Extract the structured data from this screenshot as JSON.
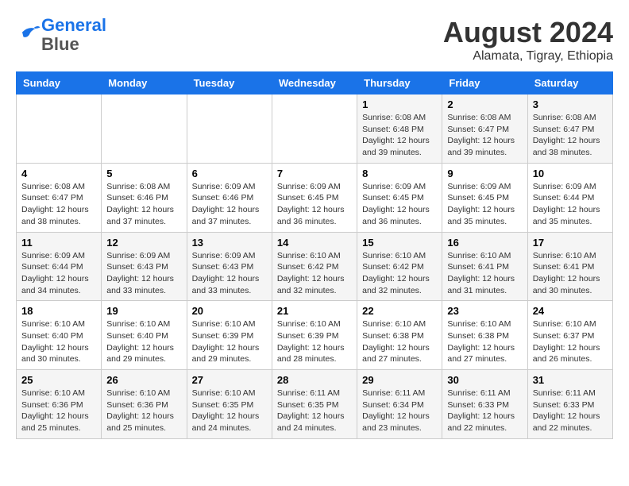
{
  "header": {
    "logo_line1": "General",
    "logo_line2": "Blue",
    "month": "August 2024",
    "location": "Alamata, Tigray, Ethiopia"
  },
  "weekdays": [
    "Sunday",
    "Monday",
    "Tuesday",
    "Wednesday",
    "Thursday",
    "Friday",
    "Saturday"
  ],
  "weeks": [
    [
      {
        "num": "",
        "info": ""
      },
      {
        "num": "",
        "info": ""
      },
      {
        "num": "",
        "info": ""
      },
      {
        "num": "",
        "info": ""
      },
      {
        "num": "1",
        "info": "Sunrise: 6:08 AM\nSunset: 6:48 PM\nDaylight: 12 hours\nand 39 minutes."
      },
      {
        "num": "2",
        "info": "Sunrise: 6:08 AM\nSunset: 6:47 PM\nDaylight: 12 hours\nand 39 minutes."
      },
      {
        "num": "3",
        "info": "Sunrise: 6:08 AM\nSunset: 6:47 PM\nDaylight: 12 hours\nand 38 minutes."
      }
    ],
    [
      {
        "num": "4",
        "info": "Sunrise: 6:08 AM\nSunset: 6:47 PM\nDaylight: 12 hours\nand 38 minutes."
      },
      {
        "num": "5",
        "info": "Sunrise: 6:08 AM\nSunset: 6:46 PM\nDaylight: 12 hours\nand 37 minutes."
      },
      {
        "num": "6",
        "info": "Sunrise: 6:09 AM\nSunset: 6:46 PM\nDaylight: 12 hours\nand 37 minutes."
      },
      {
        "num": "7",
        "info": "Sunrise: 6:09 AM\nSunset: 6:45 PM\nDaylight: 12 hours\nand 36 minutes."
      },
      {
        "num": "8",
        "info": "Sunrise: 6:09 AM\nSunset: 6:45 PM\nDaylight: 12 hours\nand 36 minutes."
      },
      {
        "num": "9",
        "info": "Sunrise: 6:09 AM\nSunset: 6:45 PM\nDaylight: 12 hours\nand 35 minutes."
      },
      {
        "num": "10",
        "info": "Sunrise: 6:09 AM\nSunset: 6:44 PM\nDaylight: 12 hours\nand 35 minutes."
      }
    ],
    [
      {
        "num": "11",
        "info": "Sunrise: 6:09 AM\nSunset: 6:44 PM\nDaylight: 12 hours\nand 34 minutes."
      },
      {
        "num": "12",
        "info": "Sunrise: 6:09 AM\nSunset: 6:43 PM\nDaylight: 12 hours\nand 33 minutes."
      },
      {
        "num": "13",
        "info": "Sunrise: 6:09 AM\nSunset: 6:43 PM\nDaylight: 12 hours\nand 33 minutes."
      },
      {
        "num": "14",
        "info": "Sunrise: 6:10 AM\nSunset: 6:42 PM\nDaylight: 12 hours\nand 32 minutes."
      },
      {
        "num": "15",
        "info": "Sunrise: 6:10 AM\nSunset: 6:42 PM\nDaylight: 12 hours\nand 32 minutes."
      },
      {
        "num": "16",
        "info": "Sunrise: 6:10 AM\nSunset: 6:41 PM\nDaylight: 12 hours\nand 31 minutes."
      },
      {
        "num": "17",
        "info": "Sunrise: 6:10 AM\nSunset: 6:41 PM\nDaylight: 12 hours\nand 30 minutes."
      }
    ],
    [
      {
        "num": "18",
        "info": "Sunrise: 6:10 AM\nSunset: 6:40 PM\nDaylight: 12 hours\nand 30 minutes."
      },
      {
        "num": "19",
        "info": "Sunrise: 6:10 AM\nSunset: 6:40 PM\nDaylight: 12 hours\nand 29 minutes."
      },
      {
        "num": "20",
        "info": "Sunrise: 6:10 AM\nSunset: 6:39 PM\nDaylight: 12 hours\nand 29 minutes."
      },
      {
        "num": "21",
        "info": "Sunrise: 6:10 AM\nSunset: 6:39 PM\nDaylight: 12 hours\nand 28 minutes."
      },
      {
        "num": "22",
        "info": "Sunrise: 6:10 AM\nSunset: 6:38 PM\nDaylight: 12 hours\nand 27 minutes."
      },
      {
        "num": "23",
        "info": "Sunrise: 6:10 AM\nSunset: 6:38 PM\nDaylight: 12 hours\nand 27 minutes."
      },
      {
        "num": "24",
        "info": "Sunrise: 6:10 AM\nSunset: 6:37 PM\nDaylight: 12 hours\nand 26 minutes."
      }
    ],
    [
      {
        "num": "25",
        "info": "Sunrise: 6:10 AM\nSunset: 6:36 PM\nDaylight: 12 hours\nand 25 minutes."
      },
      {
        "num": "26",
        "info": "Sunrise: 6:10 AM\nSunset: 6:36 PM\nDaylight: 12 hours\nand 25 minutes."
      },
      {
        "num": "27",
        "info": "Sunrise: 6:10 AM\nSunset: 6:35 PM\nDaylight: 12 hours\nand 24 minutes."
      },
      {
        "num": "28",
        "info": "Sunrise: 6:11 AM\nSunset: 6:35 PM\nDaylight: 12 hours\nand 24 minutes."
      },
      {
        "num": "29",
        "info": "Sunrise: 6:11 AM\nSunset: 6:34 PM\nDaylight: 12 hours\nand 23 minutes."
      },
      {
        "num": "30",
        "info": "Sunrise: 6:11 AM\nSunset: 6:33 PM\nDaylight: 12 hours\nand 22 minutes."
      },
      {
        "num": "31",
        "info": "Sunrise: 6:11 AM\nSunset: 6:33 PM\nDaylight: 12 hours\nand 22 minutes."
      }
    ]
  ]
}
